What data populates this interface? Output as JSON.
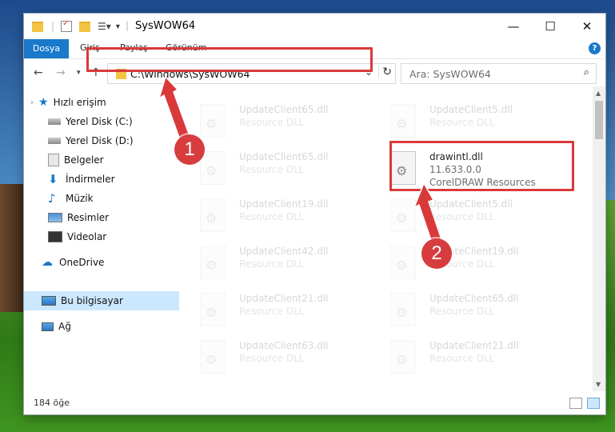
{
  "window": {
    "title": "SysWOW64"
  },
  "ribbon": {
    "tabs": [
      "Dosya",
      "Giriş",
      "Paylaş",
      "Görünüm"
    ],
    "help": "?"
  },
  "address": {
    "path": "C:\\Windows\\SysWOW64"
  },
  "search": {
    "placeholder": "Ara: SysWOW64"
  },
  "sidebar": {
    "quick_access": "Hızlı erişim",
    "items": [
      "Yerel Disk (C:)",
      "Yerel Disk (D:)",
      "Belgeler",
      "İndirmeler",
      "Müzik",
      "Resimler",
      "Videolar"
    ],
    "onedrive": "OneDrive",
    "this_pc": "Bu bilgisayar",
    "network": "Ağ"
  },
  "files": {
    "left": [
      {
        "name": "UpdateClient65.dll",
        "desc": "Resource DLL"
      },
      {
        "name": "UpdateClient65.dll",
        "desc": "Resource DLL"
      },
      {
        "name": "UpdateClient19.dll",
        "desc": "Resource DLL"
      },
      {
        "name": "UpdateClient42.dll",
        "desc": "Resource DLL"
      },
      {
        "name": "UpdateClient21.dll",
        "desc": "Resource DLL"
      },
      {
        "name": "UpdateClient63.dll",
        "desc": "Resource DLL"
      }
    ],
    "right": [
      {
        "name": "UpdateClient5.dll",
        "desc": "Resource DLL"
      },
      {
        "name": "UpdateClient5.dll",
        "desc": "Resource DLL"
      },
      {
        "name": "UpdateClient19.dll",
        "desc": "Resource DLL"
      },
      {
        "name": "UpdateClient65.dll",
        "desc": "Resource DLL"
      },
      {
        "name": "UpdateClient21.dll",
        "desc": "Resource DLL"
      }
    ],
    "highlighted": {
      "name": "drawintl.dll",
      "version": "11.633.0.0",
      "desc": "CorelDRAW Resources"
    }
  },
  "status": {
    "count": "184 öğe"
  },
  "annotations": {
    "badge1": "1",
    "badge2": "2",
    "color": "#d9393a"
  }
}
